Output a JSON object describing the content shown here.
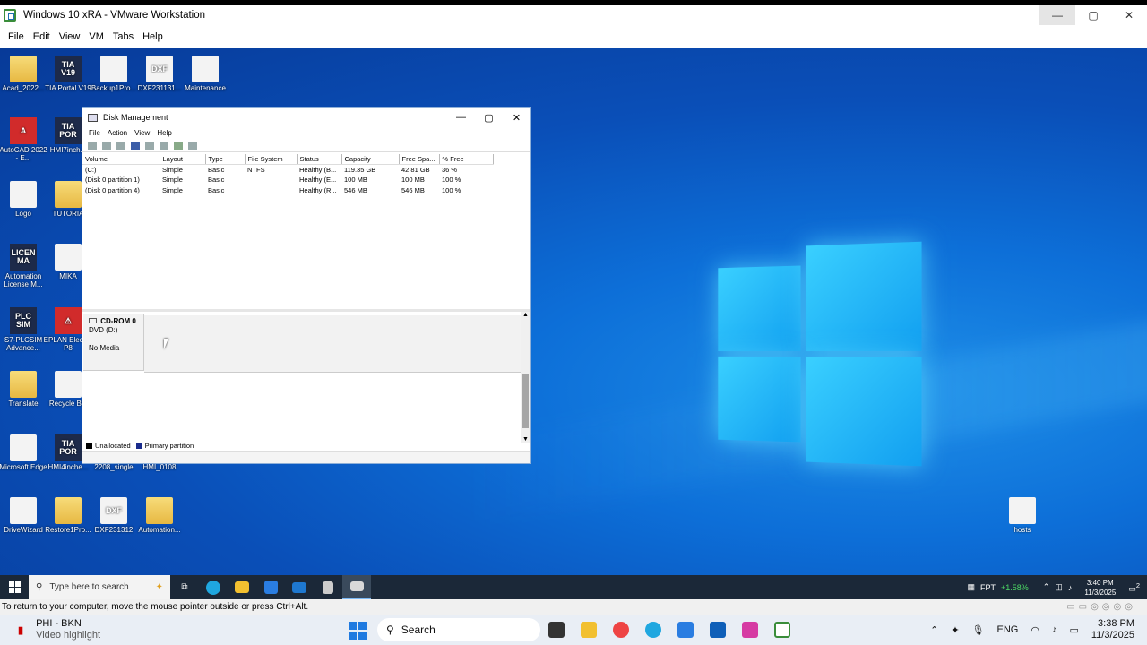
{
  "vmware": {
    "title": "Windows 10 xRA - VMware Workstation",
    "menu": [
      "File",
      "Edit",
      "View",
      "VM",
      "Tabs",
      "Help"
    ],
    "controls": {
      "minimize": "—",
      "maximize": "▢",
      "close": "✕"
    }
  },
  "desktop_icons": [
    {
      "label": "Acad_2022...",
      "glyph": "",
      "kind": "folder"
    },
    {
      "label": "TIA Portal V19",
      "glyph": "TIA V19",
      "kind": "tia"
    },
    {
      "label": "Backup1Pro...",
      "glyph": "",
      "kind": "doc"
    },
    {
      "label": "DXF231131...",
      "glyph": "DXF",
      "kind": "doc"
    },
    {
      "label": "Maintenance",
      "glyph": "",
      "kind": "doc"
    },
    {
      "label": "AutoCAD 2022 - E...",
      "glyph": "A",
      "kind": "red"
    },
    {
      "label": "HMI7inch...",
      "glyph": "TIA POR",
      "kind": "tia"
    },
    {
      "label": "Logo",
      "glyph": "",
      "kind": "doc"
    },
    {
      "label": "TUTORIA",
      "glyph": "",
      "kind": "folder"
    },
    {
      "label": "Automation License M...",
      "glyph": "LICEN MA",
      "kind": "tia"
    },
    {
      "label": "MIKA",
      "glyph": "",
      "kind": "doc"
    },
    {
      "label": "S7-PLCSIM Advance...",
      "glyph": "PLC SIM",
      "kind": "tia"
    },
    {
      "label": "EPLAN Electric P8",
      "glyph": "⚠",
      "kind": "red"
    },
    {
      "label": "Translate",
      "glyph": "",
      "kind": "folder"
    },
    {
      "label": "Recycle Bin",
      "glyph": "",
      "kind": "doc"
    },
    {
      "label": "Microsoft Edge",
      "glyph": "",
      "kind": "doc"
    },
    {
      "label": "HMI4inche...",
      "glyph": "TIA POR",
      "kind": "tia"
    },
    {
      "label": "2208_single",
      "glyph": "",
      "kind": "doc"
    },
    {
      "label": "HMI_0108",
      "glyph": "",
      "kind": "doc"
    },
    {
      "label": "DriveWizard",
      "glyph": "",
      "kind": "doc"
    },
    {
      "label": "Restore1Pro...",
      "glyph": "",
      "kind": "folder"
    },
    {
      "label": "DXF231312",
      "glyph": "DXF",
      "kind": "doc"
    },
    {
      "label": "Automation...",
      "glyph": "",
      "kind": "folder"
    },
    {
      "label": "hosts",
      "glyph": "",
      "kind": "doc"
    }
  ],
  "disk_mgmt": {
    "title": "Disk Management",
    "menu": [
      "File",
      "Action",
      "View",
      "Help"
    ],
    "columns": [
      "Volume",
      "Layout",
      "Type",
      "File System",
      "Status",
      "Capacity",
      "Free Spa...",
      "% Free"
    ],
    "rows": [
      [
        "(C:)",
        "Simple",
        "Basic",
        "NTFS",
        "Healthy (B...",
        "119.35 GB",
        "42.81 GB",
        "36 %"
      ],
      [
        "(Disk 0 partition 1)",
        "Simple",
        "Basic",
        "",
        "Healthy (E...",
        "100 MB",
        "100 MB",
        "100 %"
      ],
      [
        "(Disk 0 partition 4)",
        "Simple",
        "Basic",
        "",
        "Healthy (R...",
        "546 MB",
        "546 MB",
        "100 %"
      ]
    ],
    "cdrom": {
      "name": "CD-ROM 0",
      "drive": "DVD (D:)",
      "media": "No Media"
    },
    "legend": [
      {
        "label": "Unallocated",
        "color": "#000000"
      },
      {
        "label": "Primary partition",
        "color": "#1a2b8c"
      }
    ]
  },
  "guest_taskbar": {
    "search_placeholder": "Type here to search",
    "stock": "FPT",
    "stock_change": "+1.58%",
    "time": "3:40 PM",
    "date": "11/3/2025",
    "notif_count": "2"
  },
  "vmware_hint": "To return to your computer, move the mouse pointer outside or press Ctrl+Alt.",
  "host_taskbar": {
    "media_title": "PHI - BKN",
    "media_sub": "Video highlight",
    "search_label": "Search",
    "lang": "ENG",
    "time": "3:38 PM",
    "date": "11/3/2025"
  },
  "colors": {
    "accent": "#0a6ed8",
    "taskbar": "#1b2838",
    "change_up": "#4cd964"
  }
}
